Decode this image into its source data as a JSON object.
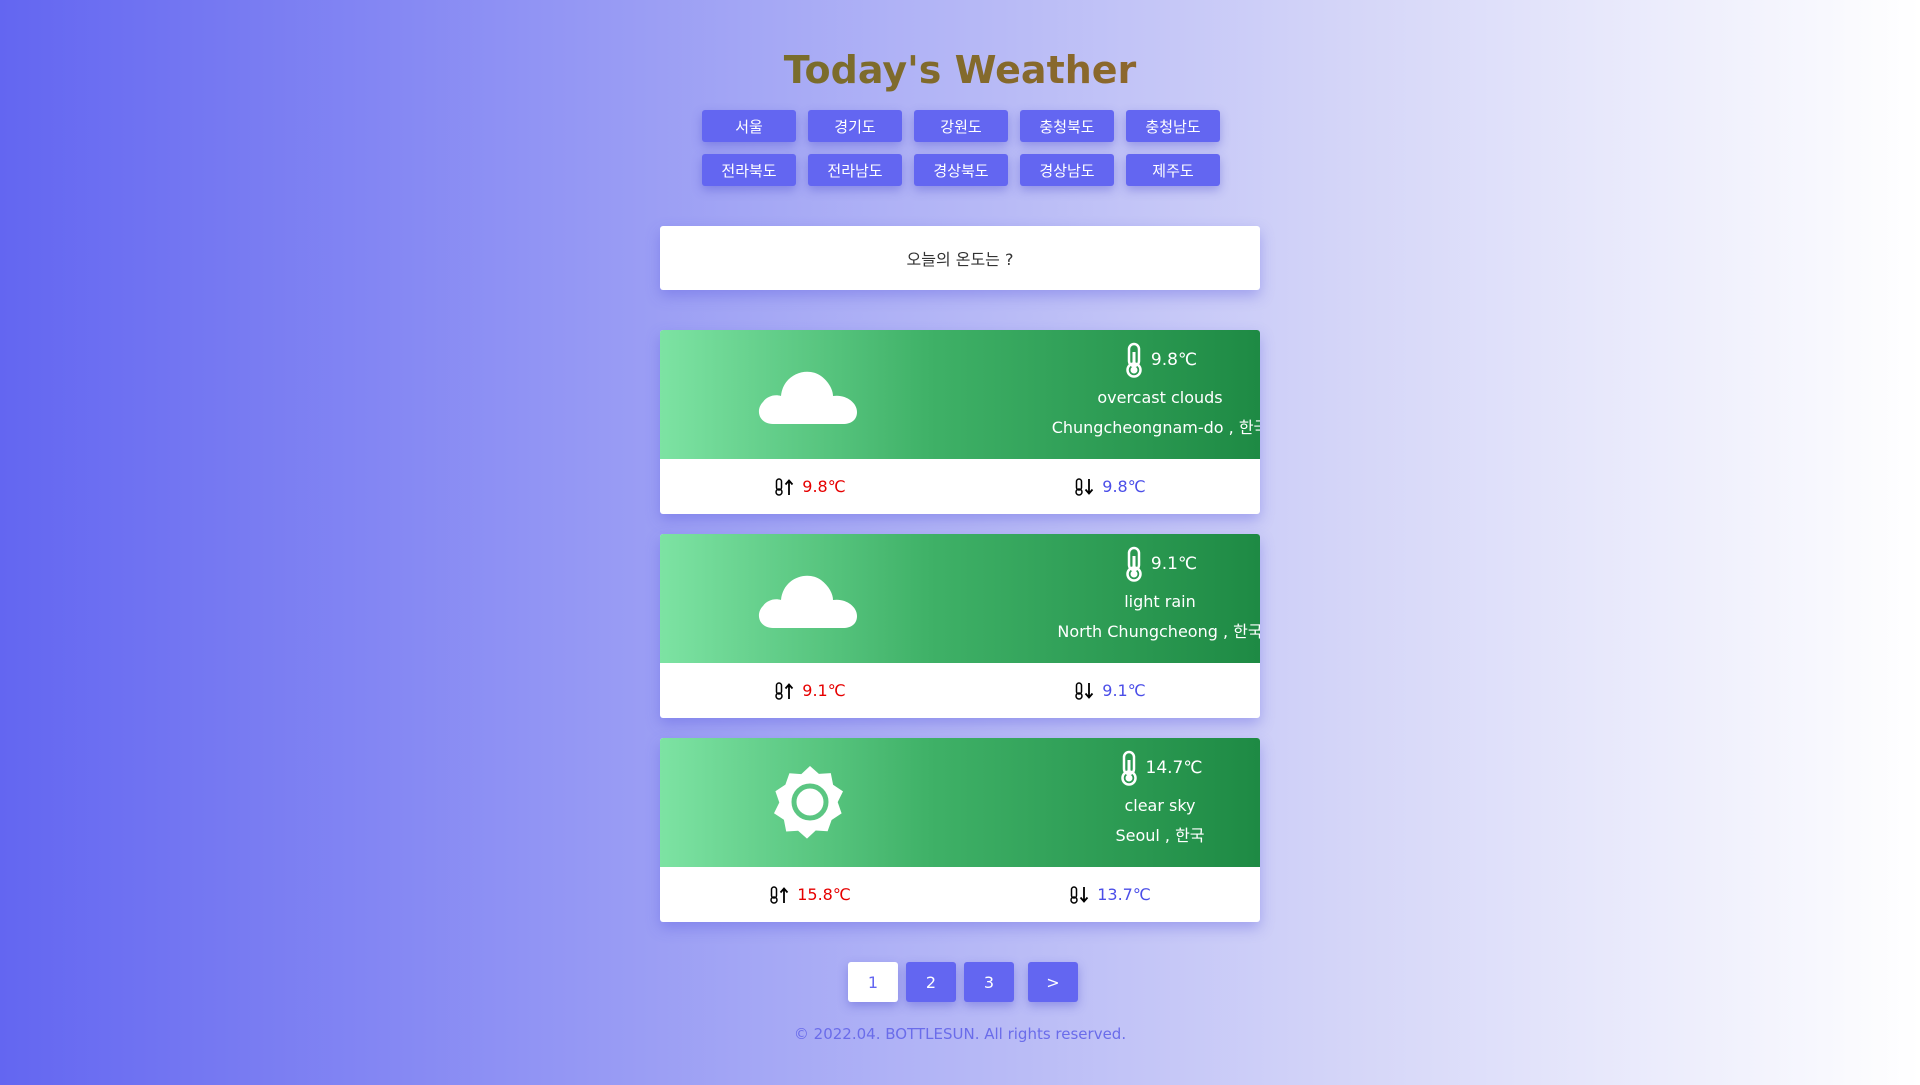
{
  "header": {
    "title": "Today's Weather"
  },
  "regions": [
    "서울",
    "경기도",
    "강원도",
    "충청북도",
    "충청남도",
    "전라북도",
    "전라남도",
    "경상북도",
    "경상남도",
    "제주도"
  ],
  "search": {
    "prompt": "오늘의 온도는 ?"
  },
  "cards": [
    {
      "icon": "cloud-icon",
      "temp": "9.8℃",
      "desc": "overcast clouds",
      "location": "Chungcheongnam-do , 한국",
      "max": "9.8℃",
      "min": "9.8℃"
    },
    {
      "icon": "cloud-icon",
      "temp": "9.1℃",
      "desc": "light rain",
      "location": "North Chungcheong , 한국",
      "max": "9.1℃",
      "min": "9.1℃"
    },
    {
      "icon": "sun-icon",
      "temp": "14.7℃",
      "desc": "clear sky",
      "location": "Seoul , 한국",
      "max": "15.8℃",
      "min": "13.7℃"
    }
  ],
  "pagination": {
    "pages": [
      "1",
      "2",
      "3"
    ],
    "next": ">",
    "current": "1"
  },
  "footer": {
    "text": "© 2022.04. BOTTLESUN. All rights reserved."
  },
  "colors": {
    "accent": "#6366f1",
    "max_temp": "#e60000",
    "min_temp": "#4b4ee8",
    "card_green": "#1e8a44"
  }
}
